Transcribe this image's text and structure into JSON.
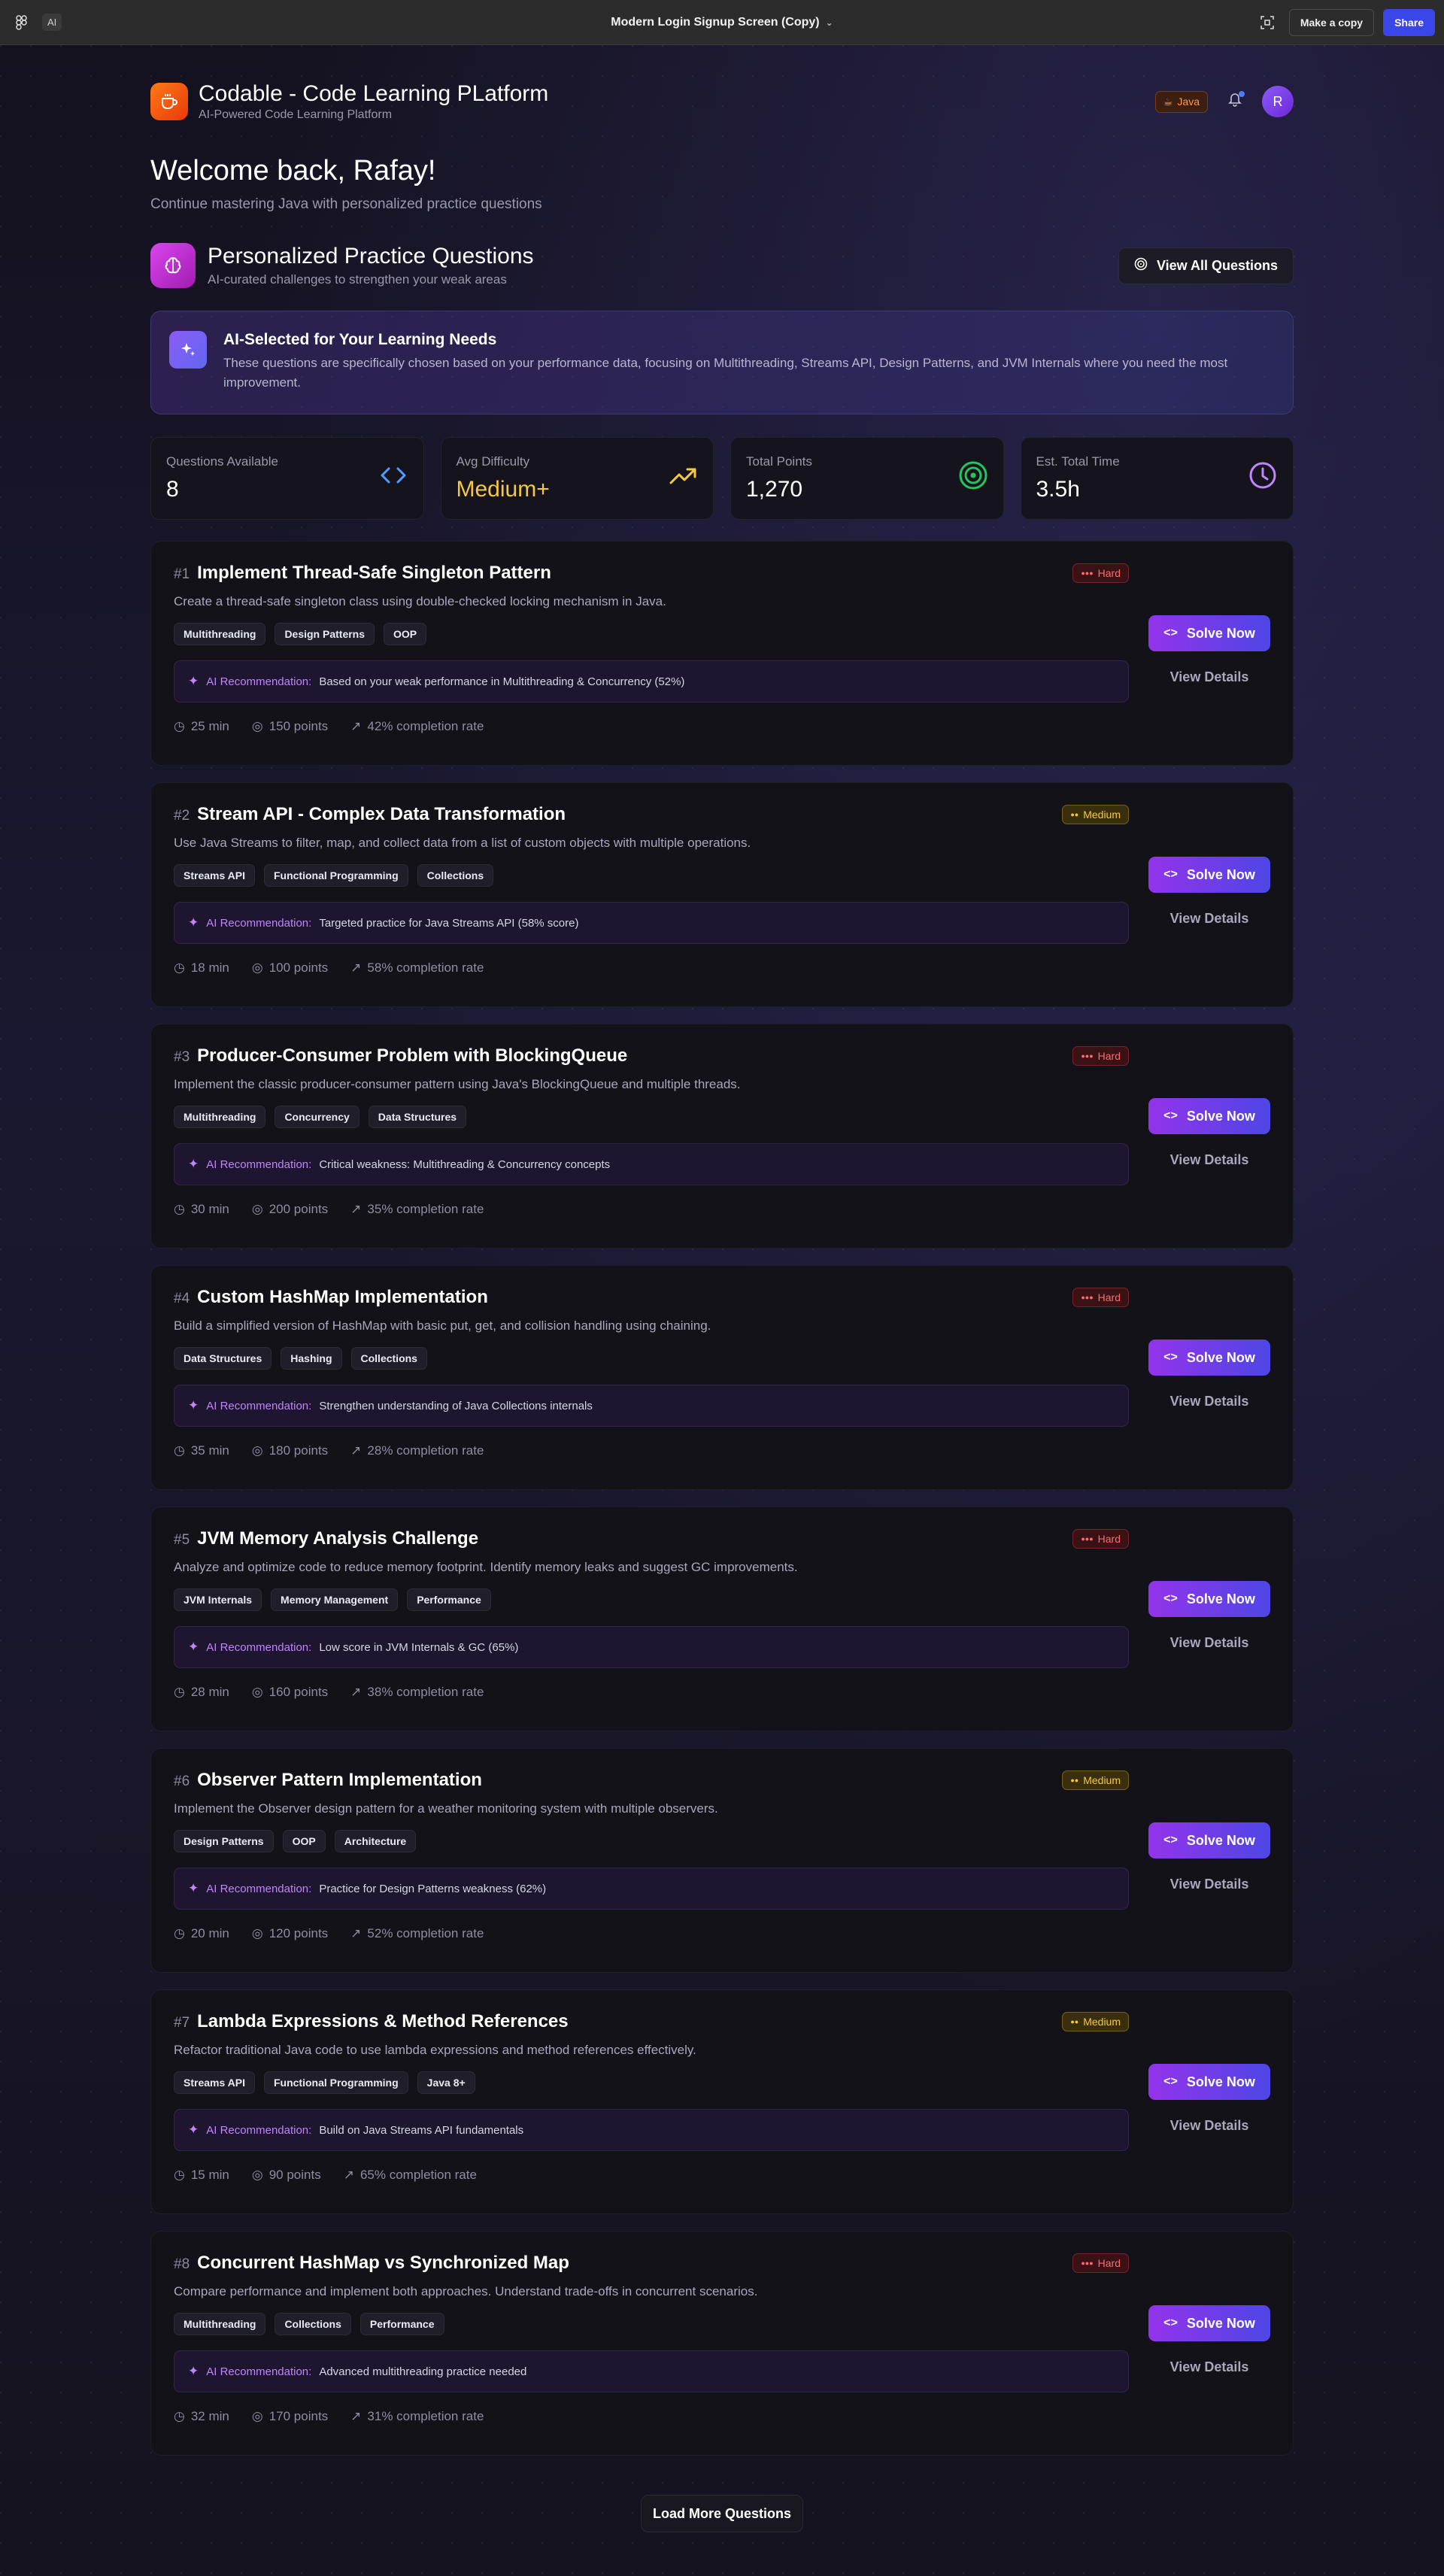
{
  "topbar": {
    "ai_label": "AI",
    "title": "Modern Login Signup Screen (Copy)",
    "make_copy": "Make a copy",
    "share": "Share"
  },
  "header": {
    "brand_title": "Codable - Code Learning PLatform",
    "brand_sub": "AI-Powered Code Learning Platform",
    "language": "Java",
    "avatar_initial": "R"
  },
  "welcome": {
    "title": "Welcome back, Rafay!",
    "subtitle": "Continue mastering Java with personalized practice questions"
  },
  "section": {
    "title": "Personalized Practice Questions",
    "subtitle": "AI-curated challenges to strengthen your weak areas",
    "view_all": "View All Questions"
  },
  "banner": {
    "title": "AI-Selected for Your Learning Needs",
    "text": "These questions are specifically chosen based on your performance data, focusing on Multithreading, Streams API, Design Patterns, and JVM Internals where you need the most improvement."
  },
  "stats": [
    {
      "label": "Questions Available",
      "value": "8",
      "icon": "code-icon",
      "color": "#4f9dff"
    },
    {
      "label": "Avg Difficulty",
      "value": "Medium+",
      "icon": "trending-up-icon",
      "color": "#f5c842"
    },
    {
      "label": "Total Points",
      "value": "1,270",
      "icon": "target-icon",
      "color": "#22c55e"
    },
    {
      "label": "Est. Total Time",
      "value": "3.5h",
      "icon": "clock-icon",
      "color": "#c084fc"
    }
  ],
  "labels": {
    "ai_rec": "AI Recommendation:",
    "solve": "Solve Now",
    "details": "View Details",
    "load_more": "Load More Questions"
  },
  "questions": [
    {
      "num": "#1",
      "title": "Implement Thread-Safe Singleton Pattern",
      "difficulty": "Hard",
      "desc": "Create a thread-safe singleton class using double-checked locking mechanism in Java.",
      "tags": [
        "Multithreading",
        "Design Patterns",
        "OOP"
      ],
      "rec": "Based on your weak performance in Multithreading & Concurrency (52%)",
      "time": "25 min",
      "points": "150 points",
      "rate": "42% completion rate"
    },
    {
      "num": "#2",
      "title": "Stream API - Complex Data Transformation",
      "difficulty": "Medium",
      "desc": "Use Java Streams to filter, map, and collect data from a list of custom objects with multiple operations.",
      "tags": [
        "Streams API",
        "Functional Programming",
        "Collections"
      ],
      "rec": "Targeted practice for Java Streams API (58% score)",
      "time": "18 min",
      "points": "100 points",
      "rate": "58% completion rate"
    },
    {
      "num": "#3",
      "title": "Producer-Consumer Problem with BlockingQueue",
      "difficulty": "Hard",
      "desc": "Implement the classic producer-consumer pattern using Java's BlockingQueue and multiple threads.",
      "tags": [
        "Multithreading",
        "Concurrency",
        "Data Structures"
      ],
      "rec": "Critical weakness: Multithreading & Concurrency concepts",
      "time": "30 min",
      "points": "200 points",
      "rate": "35% completion rate"
    },
    {
      "num": "#4",
      "title": "Custom HashMap Implementation",
      "difficulty": "Hard",
      "desc": "Build a simplified version of HashMap with basic put, get, and collision handling using chaining.",
      "tags": [
        "Data Structures",
        "Hashing",
        "Collections"
      ],
      "rec": "Strengthen understanding of Java Collections internals",
      "time": "35 min",
      "points": "180 points",
      "rate": "28% completion rate"
    },
    {
      "num": "#5",
      "title": "JVM Memory Analysis Challenge",
      "difficulty": "Hard",
      "desc": "Analyze and optimize code to reduce memory footprint. Identify memory leaks and suggest GC improvements.",
      "tags": [
        "JVM Internals",
        "Memory Management",
        "Performance"
      ],
      "rec": "Low score in JVM Internals & GC (65%)",
      "time": "28 min",
      "points": "160 points",
      "rate": "38% completion rate"
    },
    {
      "num": "#6",
      "title": "Observer Pattern Implementation",
      "difficulty": "Medium",
      "desc": "Implement the Observer design pattern for a weather monitoring system with multiple observers.",
      "tags": [
        "Design Patterns",
        "OOP",
        "Architecture"
      ],
      "rec": "Practice for Design Patterns weakness (62%)",
      "time": "20 min",
      "points": "120 points",
      "rate": "52% completion rate"
    },
    {
      "num": "#7",
      "title": "Lambda Expressions & Method References",
      "difficulty": "Medium",
      "desc": "Refactor traditional Java code to use lambda expressions and method references effectively.",
      "tags": [
        "Streams API",
        "Functional Programming",
        "Java 8+"
      ],
      "rec": "Build on Java Streams API fundamentals",
      "time": "15 min",
      "points": "90 points",
      "rate": "65% completion rate"
    },
    {
      "num": "#8",
      "title": "Concurrent HashMap vs Synchronized Map",
      "difficulty": "Hard",
      "desc": "Compare performance and implement both approaches. Understand trade-offs in concurrent scenarios.",
      "tags": [
        "Multithreading",
        "Collections",
        "Performance"
      ],
      "rec": "Advanced multithreading practice needed",
      "time": "32 min",
      "points": "170 points",
      "rate": "31% completion rate"
    }
  ]
}
